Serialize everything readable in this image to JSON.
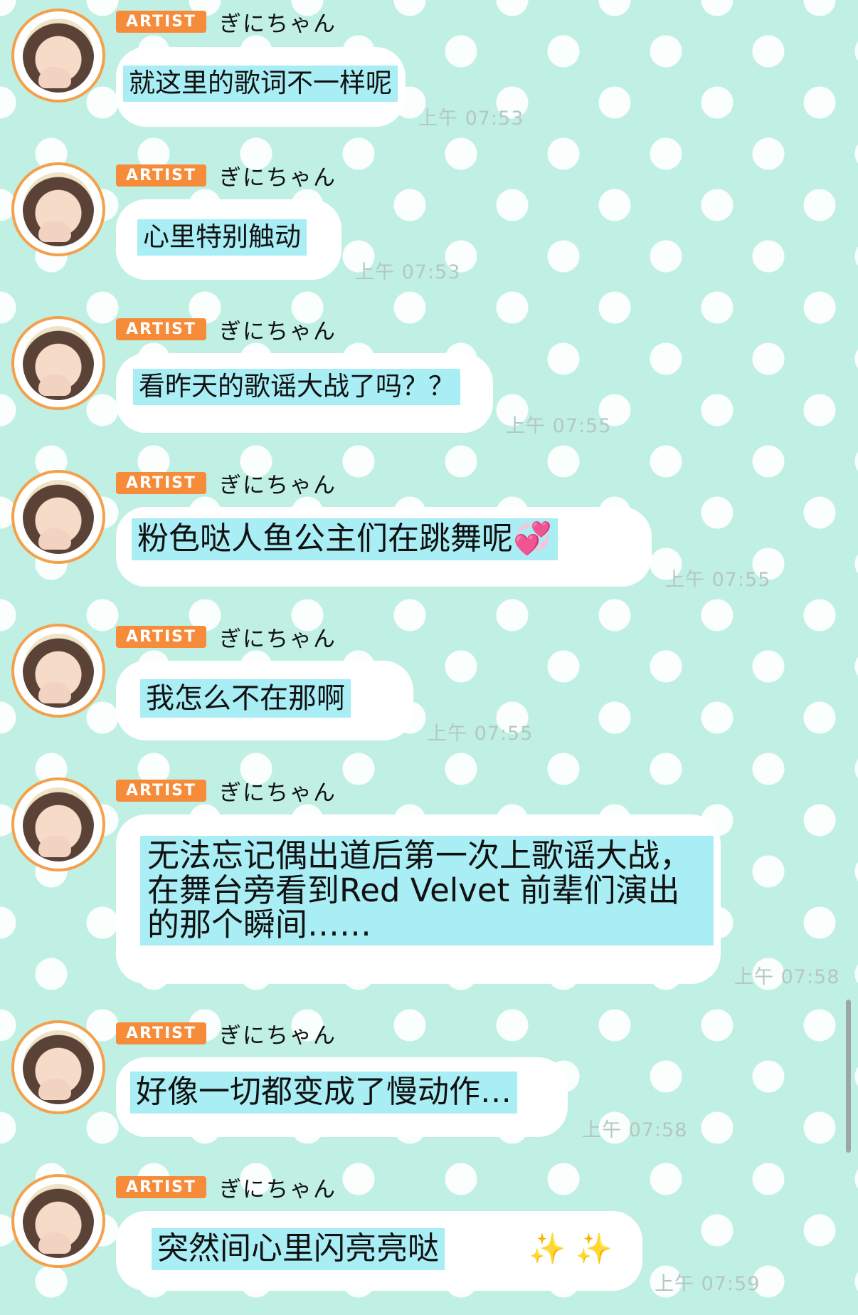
{
  "sender_badge": "ARTIST",
  "sender_name": "ぎにちゃん",
  "messages": [
    {
      "text": "就这里的歌词不一样呢",
      "time": "上午 07:53"
    },
    {
      "text": "心里特别触动",
      "time": "上午 07:53"
    },
    {
      "text": "看昨天的歌谣大战了吗？？",
      "time": "上午 07:55"
    },
    {
      "text": "粉色哒人鱼公主们在跳舞呢💞",
      "time": "上午 07:55"
    },
    {
      "text": "我怎么不在那啊",
      "time": "上午 07:55"
    },
    {
      "text": "无法忘记偶出道后第一次上歌谣大战，在舞台旁看到Red Velvet 前辈们演出的那个瞬间……",
      "time": "上午 07:58"
    },
    {
      "text": "好像一切都变成了慢动作…",
      "time": "上午 07:58"
    },
    {
      "text": "突然间心里闪亮亮哒",
      "emoji": "✨ ✨",
      "time": "上午 07:59"
    }
  ],
  "colors": {
    "background": "#bff0e3",
    "badge": "#f68b3a",
    "avatar_ring": "#f5a04a",
    "text_highlight": "#a9eef5",
    "timestamp": "#b5c7c0"
  }
}
